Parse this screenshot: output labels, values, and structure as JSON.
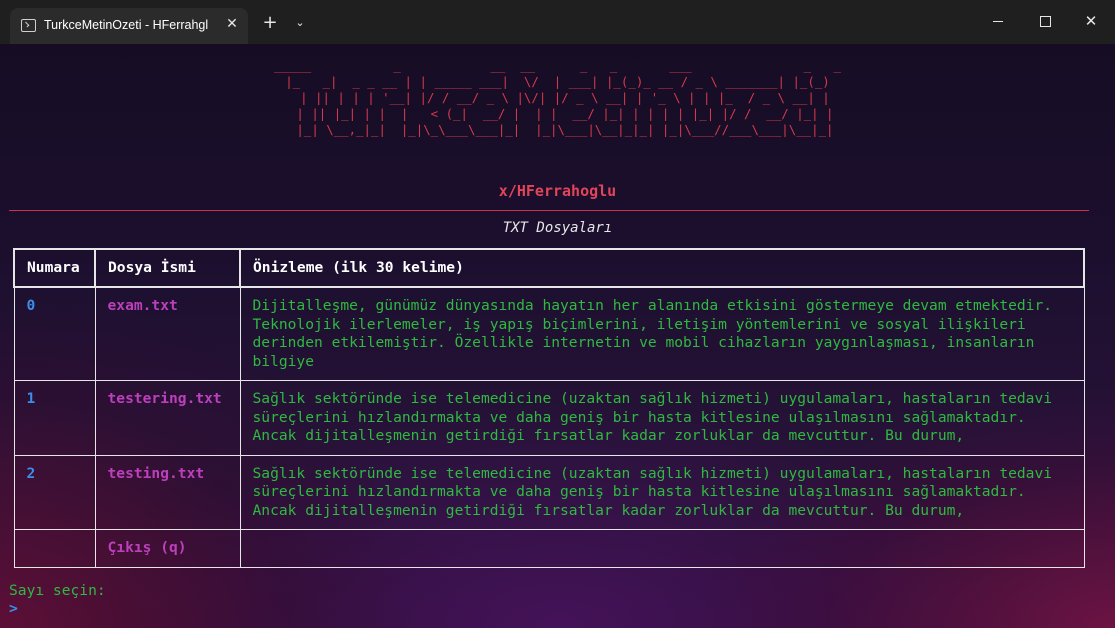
{
  "window": {
    "tab_title": "TurkceMetinOzeti - HFerrahgl",
    "new_tab_symbol": "+",
    "dropdown_symbol": "⌄",
    "minimize_icon": "minimize-icon",
    "maximize_icon": "maximize-icon",
    "close_symbol": "✕"
  },
  "banner": {
    "ascii_art": " _____           _            __  __      _   _       ___               _   _ \n|_   _|  _ _ __ | | _____ ___|  \\/  | ___| |_(_)_ __ / _ \\ _______| |_(_)\n  | || | | | '__| |/ / __/ _ \\ |\\/| |/ _ \\ __| | '_ \\ | | |_  / _ \\ __| |\n  | || |_| | |  |   < (_|  __/ |  | |  __/ |_| | | | | |_| |/ /  __/ |_| |\n  |_| \\__,_|_|  |_|\\_\\___\\___|_|  |_|\\___|\\__|_|_| |_|\\___//___\\___|\\__|_|",
    "author": "x/HFerrahoglu"
  },
  "section_title": "TXT Dosyaları",
  "table": {
    "headers": [
      "Numara",
      "Dosya İsmi",
      "Önizleme (ilk 30 kelime)"
    ],
    "rows": [
      {
        "number": "0",
        "name": "exam.txt",
        "preview": "Dijitalleşme, günümüz dünyasında hayatın her alanında etkisini göstermeye devam etmektedir. Teknolojik ilerlemeler, iş yapış biçimlerini, iletişim yöntemlerini ve sosyal ilişkileri derinden etkilemiştir. Özellikle internetin ve mobil cihazların yaygınlaşması, insanların bilgiye"
      },
      {
        "number": "1",
        "name": "testering.txt",
        "preview": "Sağlık sektöründe ise telemedicine (uzaktan sağlık hizmeti) uygulamaları, hastaların tedavi süreçlerini hızlandırmakta ve daha geniş bir hasta kitlesine ulaşılmasını sağlamaktadır. Ancak dijitalleşmenin getirdiği fırsatlar kadar zorluklar da mevcuttur. Bu durum,"
      },
      {
        "number": "2",
        "name": "testing.txt",
        "preview": "Sağlık sektöründe ise telemedicine (uzaktan sağlık hizmeti) uygulamaları, hastaların tedavi süreçlerini hızlandırmakta ve daha geniş bir hasta kitlesine ulaşılmasını sağlamaktadır. Ancak dijitalleşmenin getirdiği fırsatlar kadar zorluklar da mevcuttur. Bu durum,"
      }
    ],
    "exit_label": "Çıkış (q)"
  },
  "prompt": {
    "label": "Sayı seçin:",
    "cursor": ">"
  },
  "colors": {
    "banner": "#d63a4a",
    "number": "#3b8eea",
    "filename": "#bc3fbc",
    "preview": "#2fb941",
    "prompt": "#2fb941"
  }
}
